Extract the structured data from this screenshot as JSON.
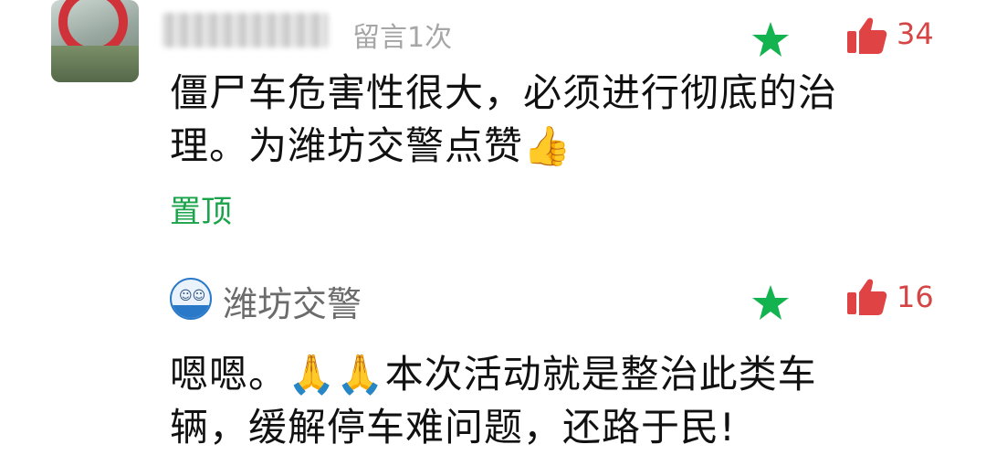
{
  "colors": {
    "star": "#13b44f",
    "like": "#e04343",
    "pin": "#1aa34a",
    "text": "#111111",
    "meta": "#a6a6a6"
  },
  "comment1": {
    "meta": "留言1次",
    "likes": "34",
    "text_line1": "僵尸车危害性很大，必须进行彻底的治",
    "text_line2": "理。为潍坊交警点赞",
    "emoji": "👍",
    "pin_label": "置顶"
  },
  "reply": {
    "author": "潍坊交警",
    "likes": "16",
    "text_line1_prefix": "嗯嗯。",
    "emoji": "🙏🙏",
    "text_line1_suffix": "本次活动就是整治此类车",
    "text_line2": "辆，缓解停车难问题，还路于民!"
  },
  "icons": [
    "user-avatar",
    "star-icon",
    "like-icon",
    "official-badge-icon"
  ]
}
